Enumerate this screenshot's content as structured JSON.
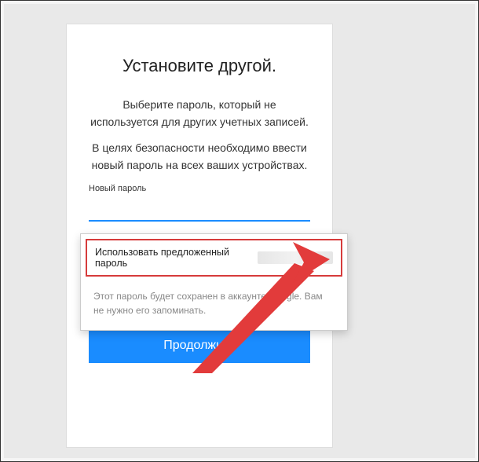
{
  "title": "Установите другой.",
  "description1": "Выберите пароль, который не используется для других учетных записей.",
  "description2": "В целях безопасности необходимо ввести новый пароль на всех ваших устройствах.",
  "field_label": "Новый пароль",
  "password_value": "",
  "continue_label": "Продолжить",
  "popup": {
    "use_suggested_label": "Использовать предложенный пароль",
    "note": "Этот пароль будет сохранен в аккаунте Google. Вам не нужно его запоминать."
  }
}
